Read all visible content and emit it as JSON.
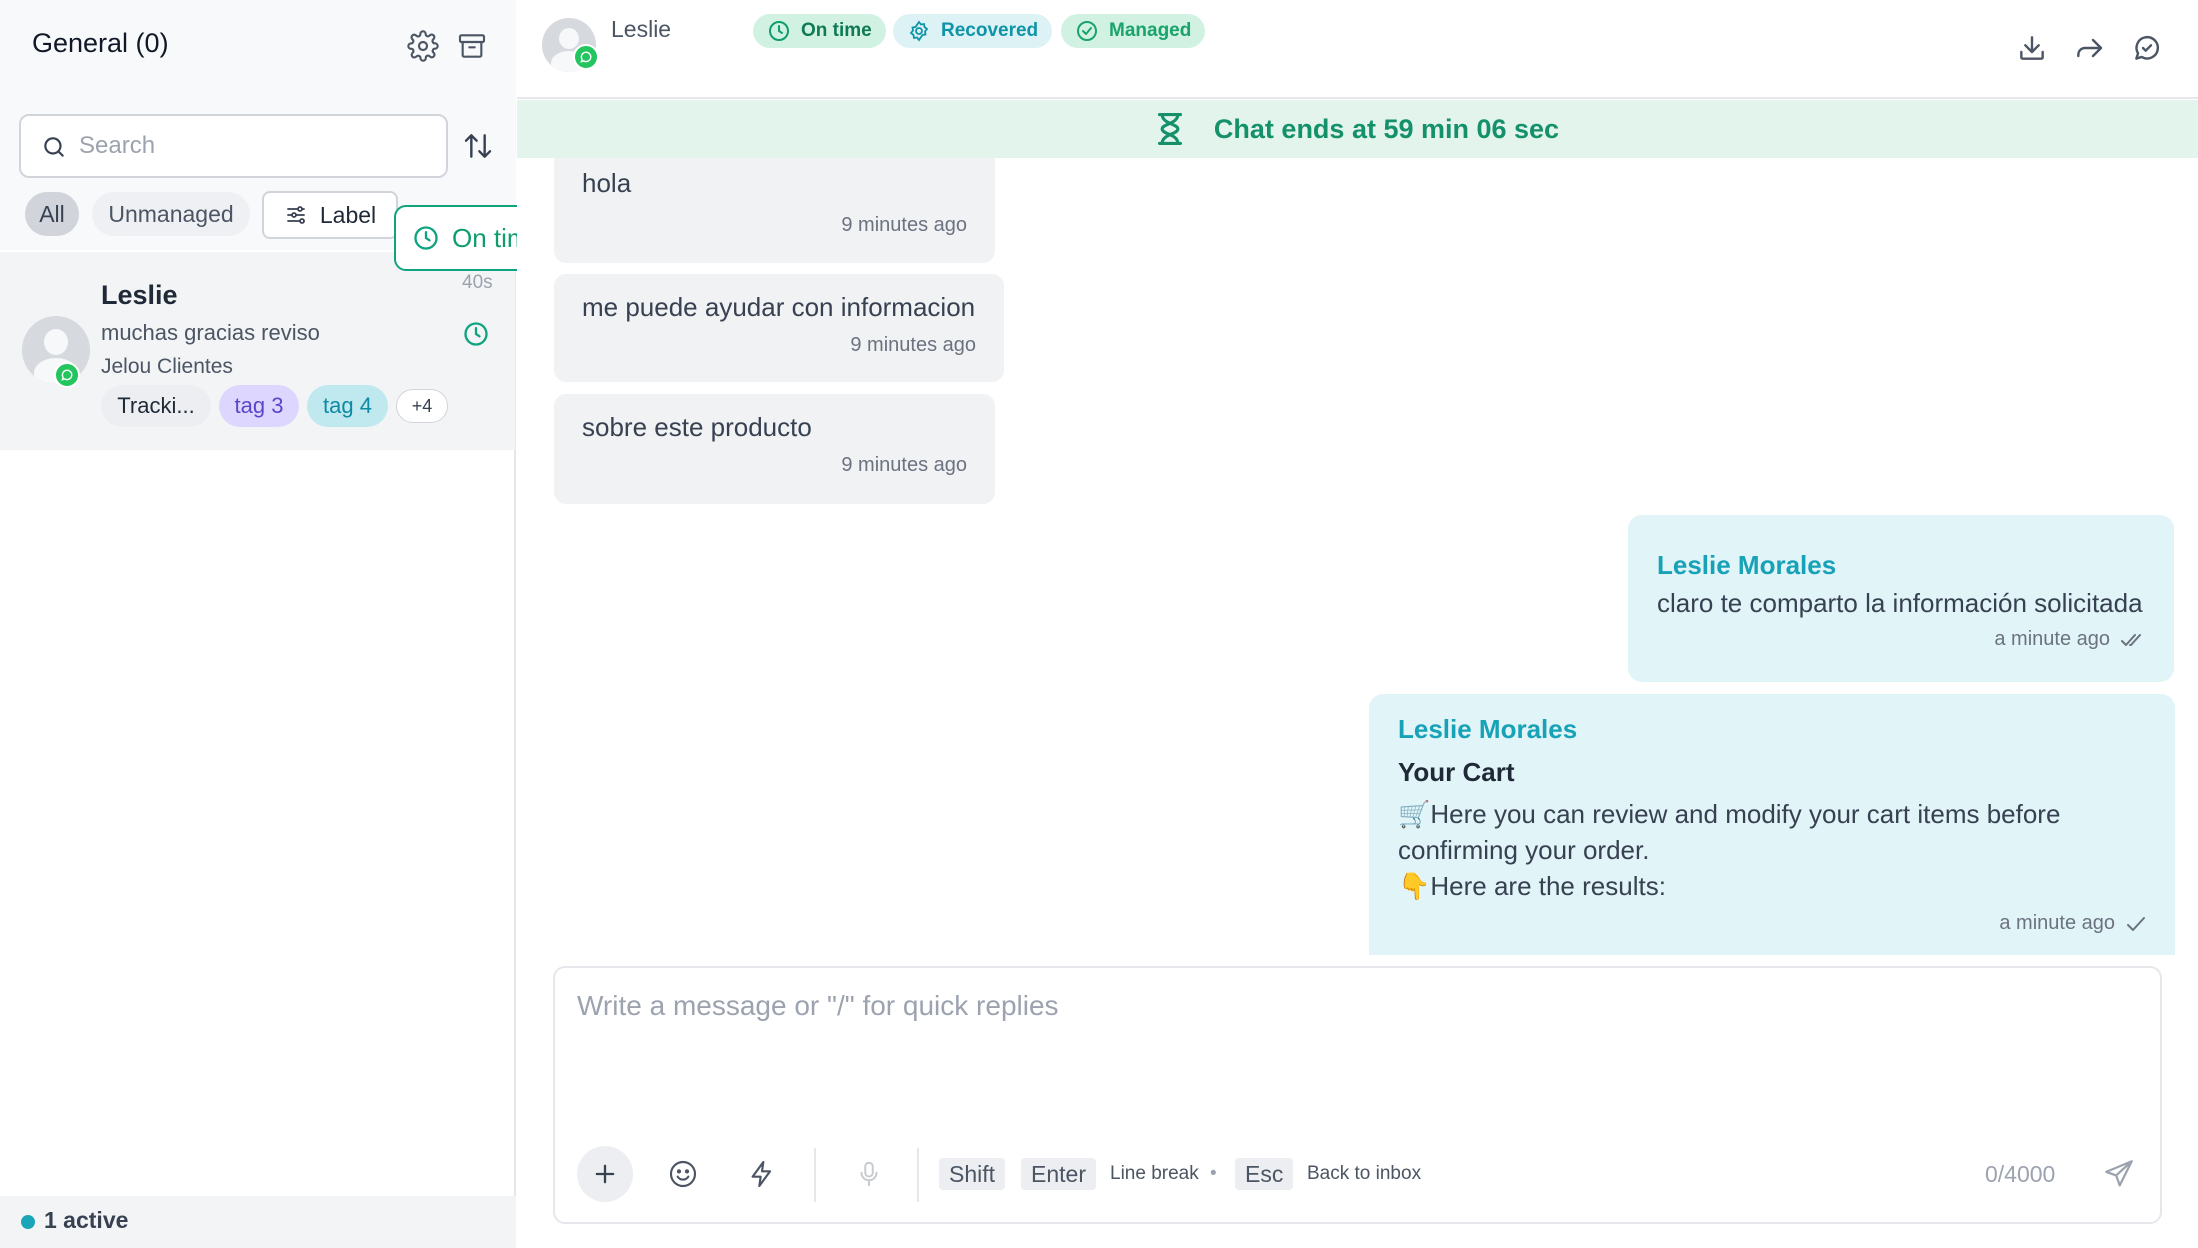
{
  "sidebar": {
    "title": "General (0)",
    "search": {
      "placeholder": "Search",
      "value": ""
    },
    "filters": {
      "all": "All",
      "unmanaged": "Unmanaged",
      "label": "Label"
    },
    "tooltip": "On time",
    "conversations": [
      {
        "name": "Leslie",
        "time": "40s",
        "preview": "muchas gracias reviso",
        "source": "Jelou Clientes",
        "tags": [
          "Tracki...",
          "tag 3",
          "tag 4",
          "+4"
        ]
      }
    ],
    "footer": {
      "active": "1 active"
    }
  },
  "header": {
    "contact_name": "Leslie",
    "chips": {
      "ontime": "On time",
      "recovered": "Recovered",
      "managed": "Managed"
    },
    "actions": [
      "download-icon",
      "forward-icon",
      "resolve-chat-icon"
    ]
  },
  "banner": {
    "text": "Chat ends at 59 min 06 sec"
  },
  "messages": {
    "incoming": [
      {
        "text": "hola",
        "time": "9 minutes ago"
      },
      {
        "text": "me puede ayudar con informacion",
        "time": "9 minutes ago"
      },
      {
        "text": "sobre este producto",
        "time": "9 minutes ago"
      }
    ],
    "outgoing": [
      {
        "sender": "Leslie Morales",
        "text": "claro te comparto la información solicitada",
        "time": "a minute ago"
      },
      {
        "sender": "Leslie Morales",
        "title": "Your Cart",
        "line1": "🛒Here you can review and modify your cart items before",
        "line2": "confirming your order.",
        "line3": "👇Here are the results:",
        "time": "a minute ago"
      }
    ]
  },
  "composer": {
    "placeholder": "Write a message or \"/\" for quick replies",
    "keys": {
      "shift": "Shift",
      "enter": "Enter",
      "esc": "Esc"
    },
    "hints": {
      "line_break": "Line break",
      "dot": "•",
      "back": "Back to inbox"
    },
    "counter": "0/4000"
  },
  "colors": {
    "accent": "#17a2b8",
    "success": "#10a37f",
    "banner_bg": "#e3f4ec",
    "outgoing_bubble": "#e1f4f7",
    "whatsapp": "#22c55e"
  }
}
